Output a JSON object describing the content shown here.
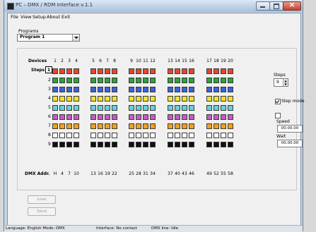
{
  "window": {
    "title": "PC – DMX / RDM Interface v.1.1"
  },
  "menu": [
    "File",
    "View",
    "Setup",
    "About",
    "Exit"
  ],
  "program": {
    "label": "Programs",
    "selected": "Program 1"
  },
  "grid": {
    "devices_label": "Devices",
    "steps_label": "Steps",
    "dmx_label": "DMX Addr.",
    "selected_step": "1",
    "device_numbers": [
      "1",
      "2",
      "3",
      "4",
      "5",
      "6",
      "7",
      "8",
      "9",
      "10",
      "11",
      "12",
      "13",
      "14",
      "15",
      "16",
      "17",
      "18",
      "19",
      "20"
    ],
    "step_numbers": [
      "1",
      "2",
      "3",
      "4",
      "5",
      "6",
      "7",
      "8",
      "9"
    ],
    "dmx_addresses": [
      "H",
      "4",
      "7",
      "10",
      "13",
      "16",
      "19",
      "22",
      "25",
      "28",
      "31",
      "34",
      "37",
      "40",
      "43",
      "46",
      "49",
      "52",
      "55",
      "58"
    ],
    "row_colors": [
      "#e8462c",
      "#2fa13b",
      "#3b62d6",
      "#f1e228",
      "#67d0dd",
      "#c35bc9",
      "#f0a11e",
      "#ffffff",
      "#111111"
    ]
  },
  "right": {
    "steps_label": "Steps",
    "steps_value": "9",
    "stepmode_label": "Step mode",
    "stepmode_checked": true,
    "speed_checked": false,
    "speed_label": "Speed",
    "speed_value": "00.00.00",
    "wait_label": "Wait",
    "wait_value": "00.00.00"
  },
  "buttons": {
    "load": "Load",
    "send": "Send"
  },
  "status": {
    "language": "Language: English  Mode: DMX",
    "interface": "Interface: No contact",
    "dmx_line": "DMX line: Idle"
  }
}
